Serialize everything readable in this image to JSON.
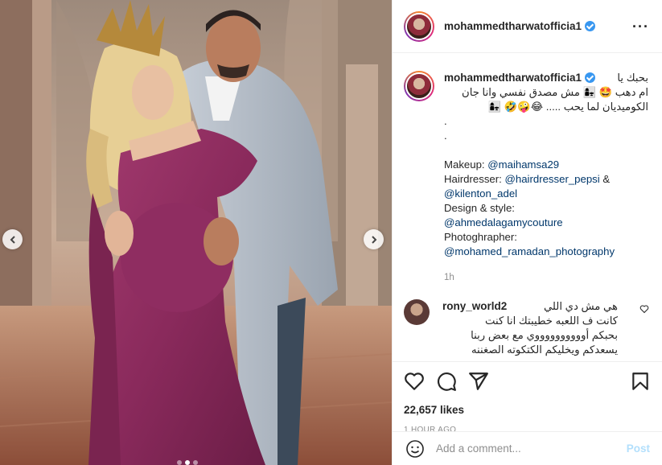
{
  "post": {
    "username": "mohammedtharwatofficia1",
    "caption_lines": [
      "بحبك يا",
      "ام دهب 🤩 👩‍👧 مش مصدق نفسي وانا جان",
      "الكوميديان لما يحب ..... 😂🤪🤣 👩‍👧"
    ],
    "caption_dots": [
      ".",
      "."
    ],
    "credits": [
      {
        "label": "Makeup: ",
        "mentions": [
          "@maihamsa29"
        ]
      },
      {
        "label": "Hairdresser: ",
        "mentions": [
          "@hairdresser_pepsi"
        ],
        "suffix": " &"
      },
      {
        "label": "",
        "mentions": [
          "@kilenton_adel"
        ]
      },
      {
        "label": "Design & style:",
        "mentions": []
      },
      {
        "label": "",
        "mentions": [
          "@ahmedalagamycouture"
        ]
      },
      {
        "label": "Photoghrapher:",
        "mentions": []
      },
      {
        "label": "",
        "mentions": [
          "@mohamed_ramadan_photography"
        ]
      }
    ],
    "caption_time": "1h"
  },
  "comment": {
    "username": "rony_world2",
    "lines": [
      "هي مش دي اللي",
      "كانت ف اللعبه خطيبتك انا كنت",
      "بحبكم أووووووووووي مع بعض ربنا",
      "يسعدكم ويخليكم الكتكوته الصغننه"
    ]
  },
  "actions": {
    "icons": [
      "heart-icon",
      "comment-icon",
      "share-icon",
      "bookmark-icon"
    ],
    "likes": "22,657 likes",
    "time_ago": "1 HOUR AGO"
  },
  "add_comment": {
    "placeholder": "Add a comment...",
    "post_label": "Post"
  },
  "colors": {
    "link": "#00376b",
    "verified": "#3897f0",
    "post_button": "#b2dffc",
    "dress": "#8a2a5c"
  }
}
